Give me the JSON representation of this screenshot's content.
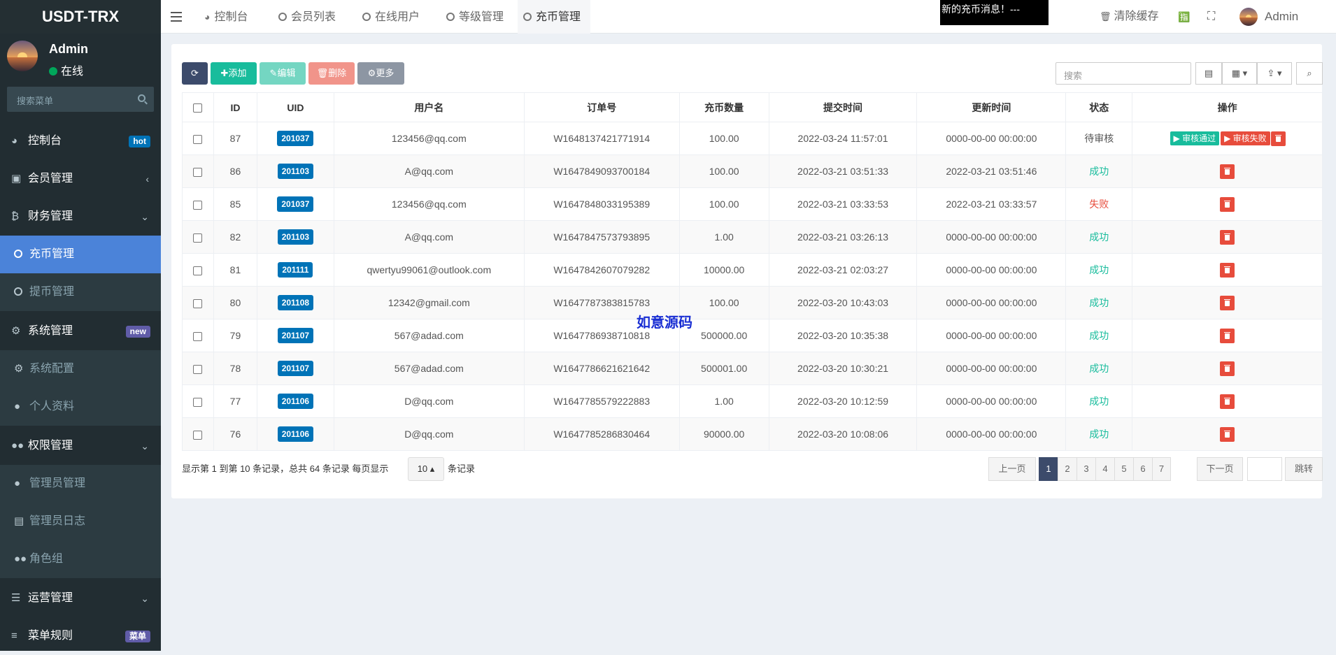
{
  "app": {
    "title": "USDT-TRX"
  },
  "user": {
    "name": "Admin",
    "status": "在线"
  },
  "sidebar": {
    "search_placeholder": "搜索菜单",
    "items": [
      {
        "label": "控制台",
        "badge": "hot"
      },
      {
        "label": "会员管理"
      },
      {
        "label": "财务管理"
      },
      {
        "label": "充币管理"
      },
      {
        "label": "提币管理"
      },
      {
        "label": "系统管理",
        "badge": "new"
      },
      {
        "label": "系统配置"
      },
      {
        "label": "个人资料"
      },
      {
        "label": "权限管理"
      },
      {
        "label": "管理员管理"
      },
      {
        "label": "管理员日志"
      },
      {
        "label": "角色组"
      },
      {
        "label": "运营管理"
      },
      {
        "label": "菜单规则",
        "badge": "菜单"
      }
    ]
  },
  "topnav": {
    "tabs": [
      {
        "label": "控制台"
      },
      {
        "label": "会员列表"
      },
      {
        "label": "在线用户"
      },
      {
        "label": "等级管理"
      },
      {
        "label": "充币管理"
      }
    ],
    "message": "新的充币消息！---",
    "clear_cache": "清除缓存",
    "user": "Admin"
  },
  "toolbar": {
    "add": "添加",
    "edit": "编辑",
    "delete": "删除",
    "more": "更多",
    "search_placeholder": "搜索"
  },
  "table": {
    "headers": [
      "ID",
      "UID",
      "用户名",
      "订单号",
      "充币数量",
      "提交时间",
      "更新时间",
      "状态",
      "操作"
    ],
    "rows": [
      {
        "id": "87",
        "uid": "201037",
        "user": "123456@qq.com",
        "order": "W1648137421771914",
        "amount": "100.00",
        "submit": "2022-03-24 11:57:01",
        "update": "0000-00-00 00:00:00",
        "status": "待审核",
        "status_type": "pending"
      },
      {
        "id": "86",
        "uid": "201103",
        "user": "A@qq.com",
        "order": "W1647849093700184",
        "amount": "100.00",
        "submit": "2022-03-21 03:51:33",
        "update": "2022-03-21 03:51:46",
        "status": "成功",
        "status_type": "ok"
      },
      {
        "id": "85",
        "uid": "201037",
        "user": "123456@qq.com",
        "order": "W1647848033195389",
        "amount": "100.00",
        "submit": "2022-03-21 03:33:53",
        "update": "2022-03-21 03:33:57",
        "status": "失败",
        "status_type": "fail"
      },
      {
        "id": "82",
        "uid": "201103",
        "user": "A@qq.com",
        "order": "W1647847573793895",
        "amount": "1.00",
        "submit": "2022-03-21 03:26:13",
        "update": "0000-00-00 00:00:00",
        "status": "成功",
        "status_type": "ok"
      },
      {
        "id": "81",
        "uid": "201111",
        "user": "qwertyu99061@outlook.com",
        "order": "W1647842607079282",
        "amount": "10000.00",
        "submit": "2022-03-21 02:03:27",
        "update": "0000-00-00 00:00:00",
        "status": "成功",
        "status_type": "ok"
      },
      {
        "id": "80",
        "uid": "201108",
        "user": "12342@gmail.com",
        "order": "W1647787383815783",
        "amount": "100.00",
        "submit": "2022-03-20 10:43:03",
        "update": "0000-00-00 00:00:00",
        "status": "成功",
        "status_type": "ok"
      },
      {
        "id": "79",
        "uid": "201107",
        "user": "567@adad.com",
        "order": "W1647786938710818",
        "amount": "500000.00",
        "submit": "2022-03-20 10:35:38",
        "update": "0000-00-00 00:00:00",
        "status": "成功",
        "status_type": "ok"
      },
      {
        "id": "78",
        "uid": "201107",
        "user": "567@adad.com",
        "order": "W1647786621621642",
        "amount": "500001.00",
        "submit": "2022-03-20 10:30:21",
        "update": "0000-00-00 00:00:00",
        "status": "成功",
        "status_type": "ok"
      },
      {
        "id": "77",
        "uid": "201106",
        "user": "D@qq.com",
        "order": "W1647785579222883",
        "amount": "1.00",
        "submit": "2022-03-20 10:12:59",
        "update": "0000-00-00 00:00:00",
        "status": "成功",
        "status_type": "ok"
      },
      {
        "id": "76",
        "uid": "201106",
        "user": "D@qq.com",
        "order": "W1647785286830464",
        "amount": "90000.00",
        "submit": "2022-03-20 10:08:06",
        "update": "0000-00-00 00:00:00",
        "status": "成功",
        "status_type": "ok"
      }
    ],
    "actions": {
      "approve": "审核通过",
      "reject": "审核失败"
    }
  },
  "footer": {
    "summary": "显示第 1 到第 10 条记录，总共 64 条记录 每页显示",
    "page_size": "10",
    "suffix": "条记录"
  },
  "pagination": {
    "prev": "上一页",
    "pages": [
      "1",
      "2",
      "3",
      "4",
      "5",
      "6",
      "7"
    ],
    "current": "1",
    "next": "下一页",
    "jump": "跳转"
  },
  "watermark": "如意源码",
  "colors": {
    "sidebar_bg": "#222d32",
    "active_menu": "#4b83d9",
    "success": "#18bc9c",
    "danger": "#e74c3c",
    "uid_badge": "#0073b7"
  }
}
